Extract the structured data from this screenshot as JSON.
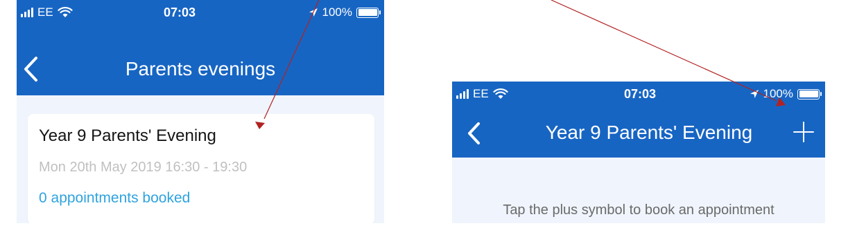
{
  "left_screen": {
    "status": {
      "carrier": "EE",
      "time": "07:03",
      "battery_text": "100%",
      "battery_level": 1.0
    },
    "nav": {
      "title": "Parents evenings",
      "back_icon": "chevron-left-icon"
    },
    "event_card": {
      "title": "Year 9 Parents' Evening",
      "datetime": "Mon 20th May 2019 16:30 - 19:30",
      "appointments": "0 appointments booked"
    }
  },
  "right_screen": {
    "status": {
      "carrier": "EE",
      "time": "07:03",
      "battery_text": "100%",
      "battery_level": 1.0
    },
    "nav": {
      "title": "Year 9 Parents' Evening",
      "back_icon": "chevron-left-icon",
      "add_icon": "plus-icon"
    },
    "empty_message": "Tap the plus symbol to book an appointment"
  },
  "colors": {
    "header_blue": "#1765c3",
    "page_background": "#f0f5fd",
    "link_blue": "#2ea3de",
    "annotation_arrow": "#b22222"
  }
}
